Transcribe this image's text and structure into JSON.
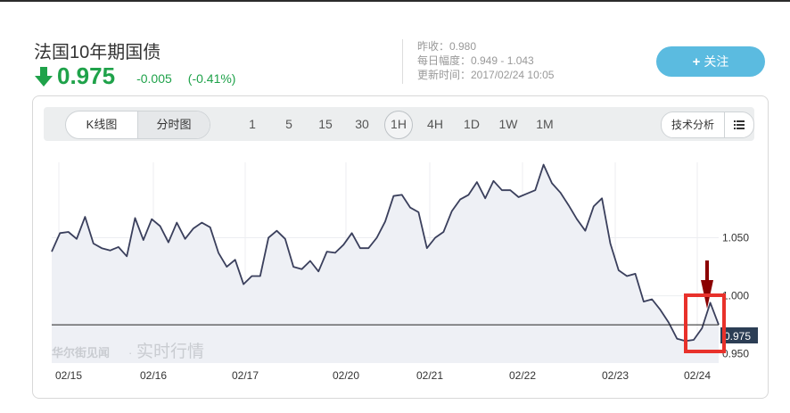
{
  "header": {
    "title": "法国10年期国债",
    "price": "0.975",
    "change": "-0.005",
    "change_pct": "(-0.41%)",
    "direction": "down",
    "color_down": "#1fa24a"
  },
  "meta": {
    "prev_close": "昨收：0.980",
    "day_range": "每日幅度：0.949 - 1.043",
    "updated": "更新时间：2017/02/24 10:05"
  },
  "follow_button": {
    "label": "关注",
    "icon": "plus-icon"
  },
  "toolbar": {
    "chart_modes": [
      {
        "label": "K线图",
        "active": false
      },
      {
        "label": "分时图",
        "active": true
      }
    ],
    "periods": [
      "1",
      "5",
      "15",
      "30",
      "1H",
      "4H",
      "1D",
      "1W",
      "1M"
    ],
    "selected_period": "1H",
    "analysis_label": "技术分析",
    "list_icon": "list-icon"
  },
  "watermark": {
    "brand": "华尔街见闻",
    "sep": "·",
    "tagline": "实时行情"
  },
  "chart_data": {
    "type": "area",
    "x_tick_labels": [
      "02/15",
      "02/16",
      "02/17",
      "02/20",
      "02/21",
      "02/22",
      "02/23",
      "02/24"
    ],
    "y_tick_labels": [
      "1.050",
      "1.000",
      "0.950"
    ],
    "ylim": [
      0.942,
      1.115
    ],
    "current_value": 0.975,
    "current_label": "0.975",
    "line_color": "#3a3f5c",
    "annotation": "red box highlighting the latest spike near 02/24",
    "values": [
      1.038,
      1.054,
      1.055,
      1.049,
      1.068,
      1.045,
      1.041,
      1.039,
      1.042,
      1.034,
      1.067,
      1.048,
      1.066,
      1.06,
      1.046,
      1.063,
      1.049,
      1.058,
      1.063,
      1.059,
      1.037,
      1.025,
      1.031,
      1.01,
      1.017,
      1.017,
      1.05,
      1.056,
      1.049,
      1.025,
      1.023,
      1.03,
      1.021,
      1.038,
      1.037,
      1.044,
      1.054,
      1.041,
      1.041,
      1.05,
      1.064,
      1.086,
      1.087,
      1.076,
      1.072,
      1.041,
      1.05,
      1.055,
      1.073,
      1.083,
      1.087,
      1.098,
      1.084,
      1.099,
      1.091,
      1.091,
      1.085,
      1.088,
      1.091,
      1.113,
      1.097,
      1.089,
      1.078,
      1.066,
      1.056,
      1.077,
      1.084,
      1.045,
      1.022,
      1.017,
      1.019,
      0.995,
      0.997,
      0.988,
      0.977,
      0.963,
      0.961,
      0.962,
      0.972,
      0.994,
      0.975
    ]
  }
}
